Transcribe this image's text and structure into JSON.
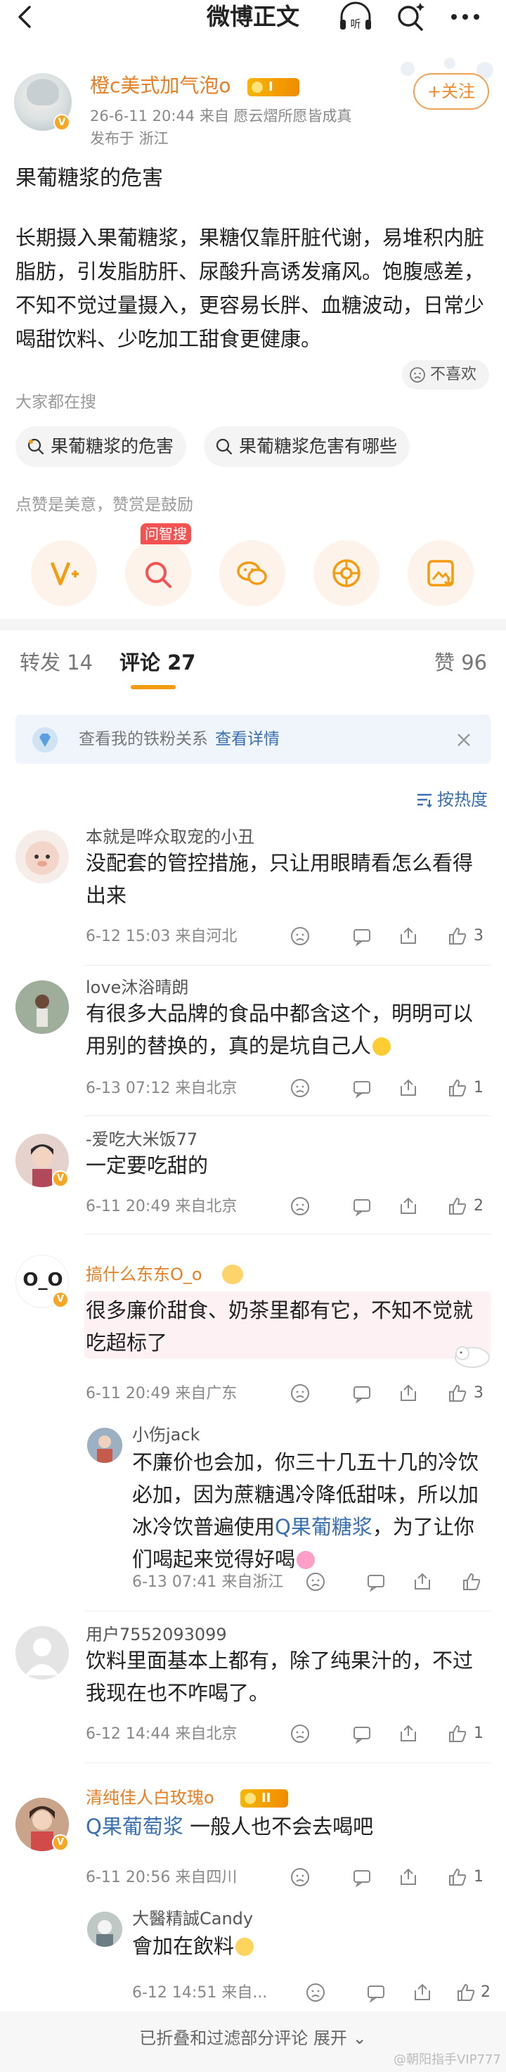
{
  "topbar": {
    "title": "微博正文"
  },
  "post": {
    "author": "橙c美式加气泡o",
    "level": "I",
    "meta_line1": "26-6-11 20:44  来自 愿云熠所愿皆成真",
    "meta_line2": "发布于 浙江",
    "follow_label": "+关注",
    "title": "果葡糖浆的危害",
    "body": "长期摄入果葡糖浆，果糖仅靠肝脏代谢，易堆积内脏脂肪，引发脂肪肝、尿酸升高诱发痛风。饱腹感差，不知不觉过量摄入，更容易长胖、血糖波动，日常少喝甜饮料、少吃加工甜食更健康。",
    "dislike_label": "不喜欢",
    "search_section_label": "大家都在搜",
    "search_chips": [
      "果葡糖浆的危害",
      "果葡糖浆危害有哪些"
    ],
    "like_hint": "点赞是美意，赞赏是鼓励",
    "ask_tag": "问智搜",
    "share_icons": [
      "vip-plus-icon",
      "ai-search-icon",
      "wechat-icon",
      "moments-icon",
      "save-image-icon"
    ]
  },
  "tabs": {
    "repost": "转发 14",
    "comment": "评论 27",
    "like": "赞 96"
  },
  "fan_banner": {
    "text": "查看我的铁粉关系",
    "link": "查看详情"
  },
  "sort_label": "按热度",
  "comments": [
    {
      "name": "本就是哗众取宠的小丑",
      "text": "没配套的管控措施，只让用眼睛看怎么看得出来",
      "meta": "6-12 15:03  来自河北",
      "likes": "3"
    },
    {
      "name": "love沐浴晴朗",
      "text": "有很多大品牌的食品中都含这个，明明可以用别的替换的，真的是坑自己人",
      "meta": "6-13 07:12  来自北京",
      "likes": "1"
    },
    {
      "name": "-爱吃大米饭77",
      "text": "一定要吃甜的",
      "meta": "6-11 20:49  来自北京",
      "likes": "2"
    },
    {
      "name": "搞什么东东O_o",
      "text": "很多廉价甜食、奶茶里都有它，不知不觉就吃超标了",
      "meta": "6-11 20:49  来自广东",
      "likes": "3",
      "avatar_text": "O_O",
      "reply": {
        "name": "小伤jack",
        "text_before": "不廉价也会加，你三十几五十几的冷饮必加，因为蔗糖遇冷降低甜味，所以加冰冷饮普遍使用",
        "link": "果葡糖浆",
        "text_after": "，为了让你们喝起来觉得好喝",
        "meta": "6-13 07:41  来自浙江"
      }
    },
    {
      "name": "用户7552093099",
      "text": "饮料里面基本上都有，除了纯果汁的，不过我现在也不咋喝了。",
      "meta": "6-12 14:44  来自北京",
      "likes": "1"
    },
    {
      "name": "清纯佳人白玫瑰o",
      "level": "II",
      "link": "果葡萄浆",
      "text": "一般人也不会去喝吧",
      "meta": "6-11 20:56  来自四川",
      "likes": "1",
      "reply": {
        "name": "大醫精誠Candy",
        "text": "會加在飲料",
        "meta": "6-12 14:51  来自...",
        "likes": "2"
      }
    }
  ],
  "fold_bar": {
    "text": "已折叠和过滤部分评论  展开",
    "watermark": "@朝阳指手VIP777"
  },
  "colors": {
    "accent_orange": "#f39c12",
    "link_blue": "#3a6fb0",
    "vip_name": "#e67e22"
  }
}
